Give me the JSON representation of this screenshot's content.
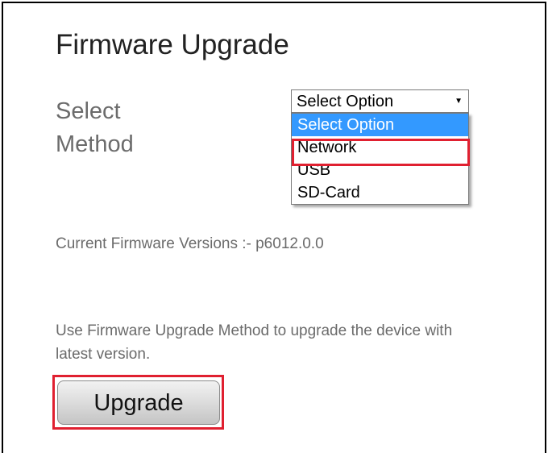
{
  "page": {
    "title": "Firmware Upgrade",
    "method_label_line1": "Select",
    "method_label_line2": "Method",
    "current_firmware": "Current Firmware Versions :- p6012.0.0",
    "description": "Use Firmware Upgrade Method to upgrade the device with latest version."
  },
  "method_select": {
    "value": "Select Option",
    "arrow_icon": "chevron-down-icon",
    "options": [
      "Select Option",
      "Network",
      "USB",
      "SD-Card"
    ],
    "highlighted_option": "Select Option",
    "annotated_option": "Network"
  },
  "actions": {
    "upgrade_label": "Upgrade"
  },
  "colors": {
    "highlight_blue": "#3399ff",
    "annotation_red": "#e02030",
    "label_gray": "#6b6b6b"
  }
}
